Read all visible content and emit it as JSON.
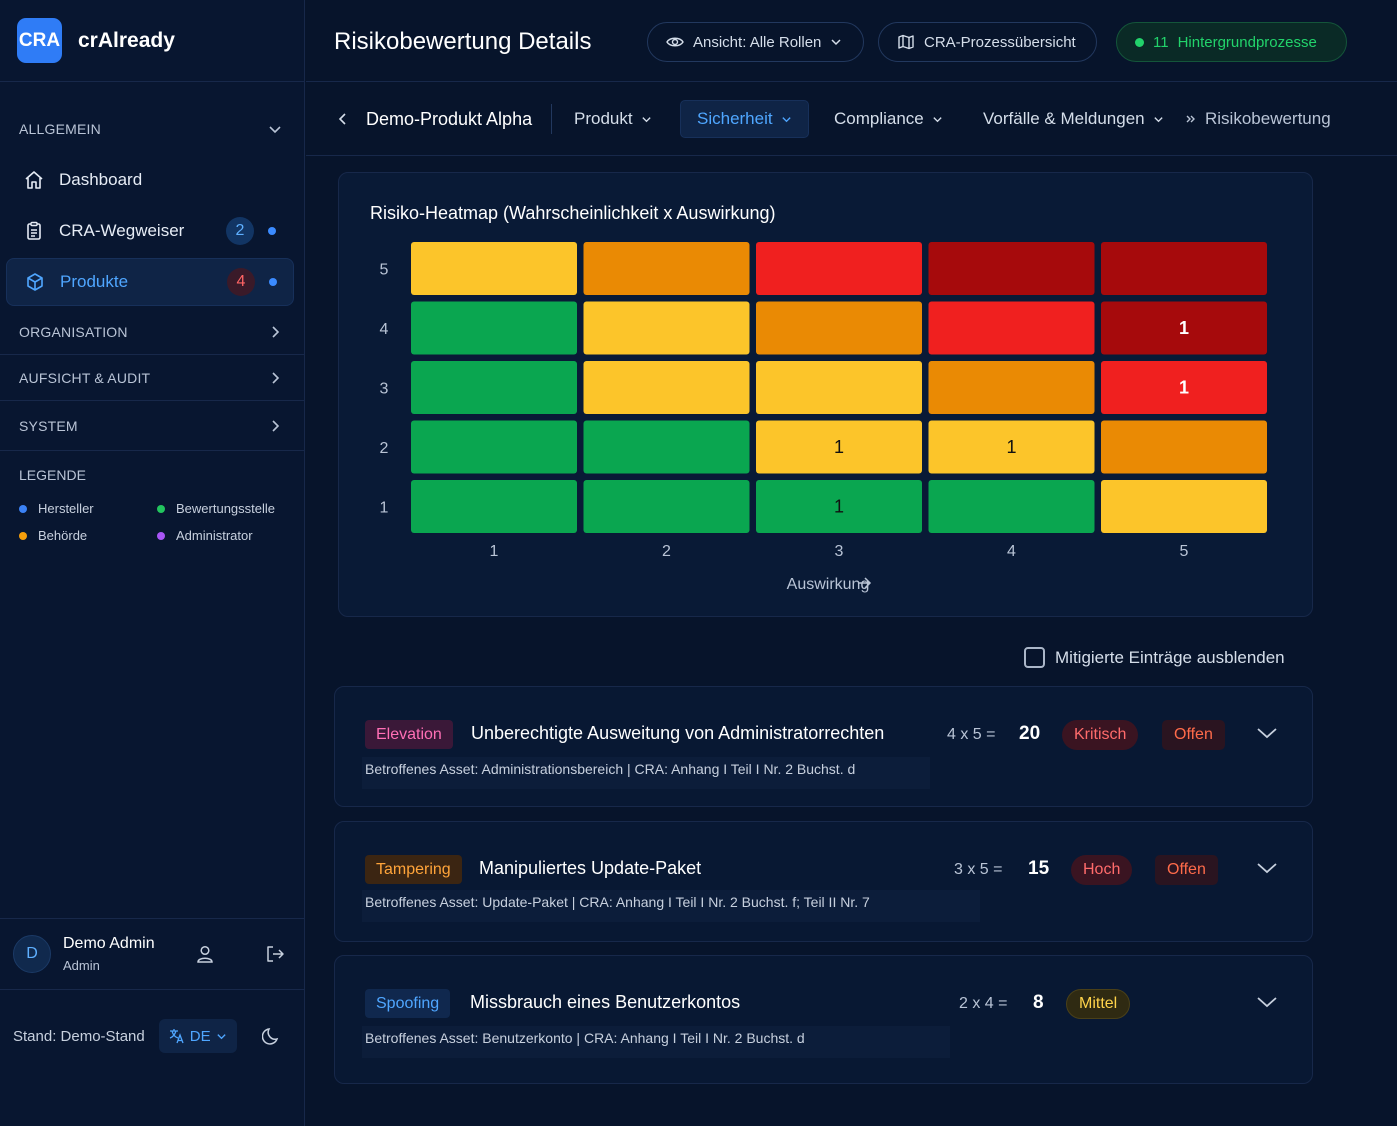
{
  "brand": {
    "logo": "CRA",
    "name": "crAlready"
  },
  "sidebar": {
    "sections": {
      "allgemein": "ALLGEMEIN",
      "organisation": "ORGANISATION",
      "aufsicht": "AUFSICHT & AUDIT",
      "system": "SYSTEM"
    },
    "items": [
      {
        "label": "Dashboard",
        "icon": "home-icon"
      },
      {
        "label": "CRA-Wegweiser",
        "icon": "clipboard-icon",
        "badge": "2"
      },
      {
        "label": "Produkte",
        "icon": "cube-icon",
        "badge": "4"
      }
    ],
    "legend": {
      "title": "LEGENDE",
      "items": [
        {
          "label": "Hersteller",
          "color": "#3b82f6"
        },
        {
          "label": "Bewertungsstelle",
          "color": "#22c55e"
        },
        {
          "label": "Behörde",
          "color": "#f59e0b"
        },
        {
          "label": "Administrator",
          "color": "#a855f7"
        }
      ]
    },
    "user": {
      "initial": "D",
      "name": "Demo Admin",
      "role": "Admin"
    },
    "footer": {
      "stand": "Stand: Demo-Stand",
      "lang": "DE"
    }
  },
  "header": {
    "title": "Risikobewertung Details",
    "view_label": "Ansicht: Alle Rollen",
    "process_label": "CRA-Prozessübersicht",
    "bg_count": "11",
    "bg_label": "Hintergrundprozesse"
  },
  "subnav": {
    "product": "Demo-Produkt Alpha",
    "tabs": [
      "Produkt",
      "Sicherheit",
      "Compliance",
      "Vorfälle & Meldungen"
    ],
    "breadcrumb": "Risikobewertung"
  },
  "heatmap": {
    "title": "Risiko-Heatmap (Wahrscheinlichkeit x Auswirkung)",
    "x_label": "Auswirkung",
    "colors": {
      "green": "#0aa650",
      "yellow": "#fcc52a",
      "orange": "#ea8a04",
      "red": "#f0201f",
      "darkred": "#a60a0c"
    }
  },
  "chart_data": {
    "type": "heatmap",
    "title": "Risiko-Heatmap (Wahrscheinlichkeit x Auswirkung)",
    "xlabel": "Auswirkung",
    "x_categories": [
      1,
      2,
      3,
      4,
      5
    ],
    "y_categories": [
      1,
      2,
      3,
      4,
      5
    ],
    "cell_levels": [
      [
        "green",
        "green",
        "green",
        "green",
        "yellow"
      ],
      [
        "green",
        "green",
        "yellow",
        "yellow",
        "orange"
      ],
      [
        "green",
        "yellow",
        "yellow",
        "orange",
        "red"
      ],
      [
        "green",
        "yellow",
        "orange",
        "red",
        "darkred"
      ],
      [
        "yellow",
        "orange",
        "red",
        "darkred",
        "darkred"
      ]
    ],
    "counts": [
      {
        "x": 3,
        "y": 1,
        "value": 1
      },
      {
        "x": 3,
        "y": 2,
        "value": 1
      },
      {
        "x": 4,
        "y": 2,
        "value": 1
      },
      {
        "x": 5,
        "y": 3,
        "value": 1
      },
      {
        "x": 5,
        "y": 4,
        "value": 1
      }
    ]
  },
  "filter": {
    "hide_mitigated": "Mitigierte Einträge ausblenden"
  },
  "risks": [
    {
      "tag": "Elevation",
      "title": "Unberechtigte Ausweitung von Administratorrechten",
      "subtitle": "Betroffenes Asset: Administrationsbereich | CRA: Anhang I Teil I Nr. 2 Buchst. d",
      "formula": "4 x 5 =",
      "score": "20",
      "level": "Kritisch",
      "status": "Offen"
    },
    {
      "tag": "Tampering",
      "title": "Manipuliertes Update-Paket",
      "subtitle": "Betroffenes Asset: Update-Paket | CRA: Anhang I Teil I Nr. 2 Buchst. f; Teil II Nr. 7",
      "formula": "3 x 5 =",
      "score": "15",
      "level": "Hoch",
      "status": "Offen"
    },
    {
      "tag": "Spoofing",
      "title": "Missbrauch eines Benutzerkontos",
      "subtitle": "Betroffenes Asset: Benutzerkonto | CRA: Anhang I Teil I Nr. 2 Buchst. d",
      "formula": "2 x 4 =",
      "score": "8",
      "level": "Mittel"
    }
  ]
}
